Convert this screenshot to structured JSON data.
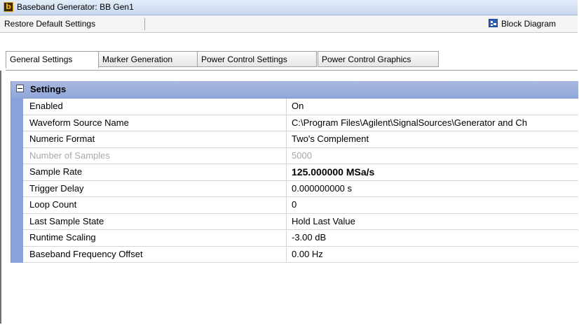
{
  "window": {
    "title": "Baseband Generator: BB Gen1"
  },
  "toolbar": {
    "restore_label": "Restore Default Settings",
    "block_diagram_label": "Block Diagram"
  },
  "tabs": [
    {
      "label": "General Settings",
      "active": true
    },
    {
      "label": "Marker Generation",
      "active": false
    },
    {
      "label": "Power Control Settings",
      "active": false
    },
    {
      "label": "Power Control Graphics",
      "active": false
    }
  ],
  "settings": {
    "category_label": "Settings",
    "rows": [
      {
        "name": "Enabled",
        "value": "On"
      },
      {
        "name": "Waveform Source Name",
        "value": "C:\\Program Files\\Agilent\\SignalSources\\Generator and Ch"
      },
      {
        "name": "Numeric Format",
        "value": "Two's Complement"
      },
      {
        "name": "Number of Samples",
        "value": "5000",
        "disabled": true
      },
      {
        "name": "Sample Rate",
        "value": "125.000000 MSa/s",
        "bold": true
      },
      {
        "name": "Trigger Delay",
        "value": "0.000000000 s"
      },
      {
        "name": "Loop Count",
        "value": "0"
      },
      {
        "name": "Last Sample State",
        "value": "Hold Last Value"
      },
      {
        "name": "Runtime Scaling",
        "value": "-3.00 dB"
      },
      {
        "name": "Baseband Frequency Offset",
        "value": "0.00 Hz"
      }
    ]
  },
  "colors": {
    "category_bar": "#9db1de",
    "gutter": "#8aa2da",
    "title_bar": "#d6e3f5"
  },
  "icons": {
    "app": "app-logo-icon",
    "block_diagram": "block-diagram-icon",
    "expand": "collapse-minus-icon"
  }
}
